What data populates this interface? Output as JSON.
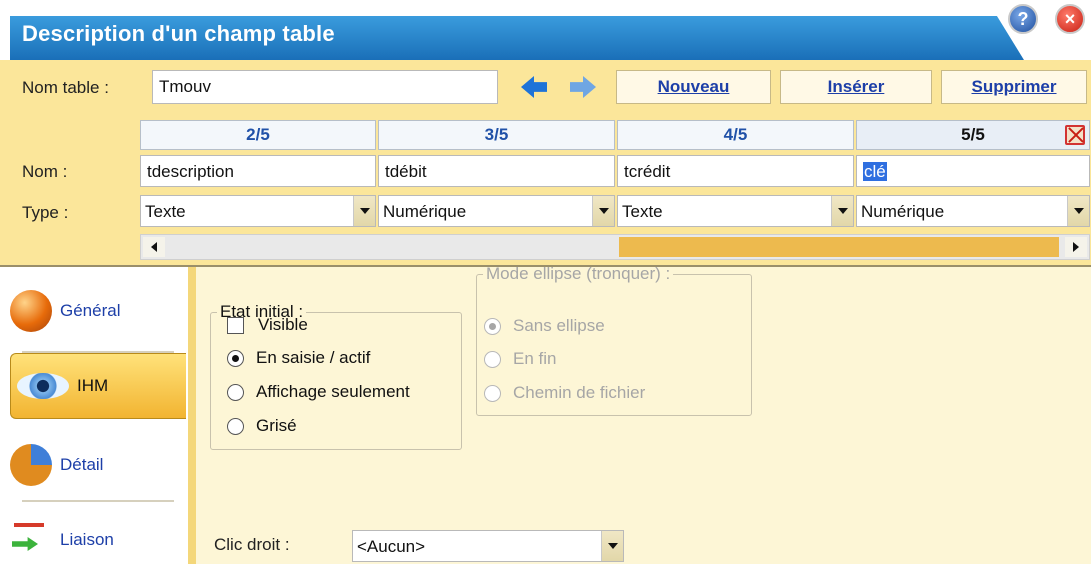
{
  "window": {
    "title": "Description d'un champ table"
  },
  "header": {
    "table_label": "Nom table :",
    "table_value": "Tmouv",
    "buttons": {
      "new": "Nouveau",
      "insert": "Insérer",
      "delete": "Supprimer"
    }
  },
  "columns": [
    {
      "head": "2/5",
      "nom": "tdescription",
      "type": "Texte"
    },
    {
      "head": "3/5",
      "nom": "tdébit",
      "type": "Numérique"
    },
    {
      "head": "4/5",
      "nom": "tcrédit",
      "type": "Texte"
    },
    {
      "head": "5/5",
      "nom": "clé",
      "type": "Numérique"
    }
  ],
  "row_labels": {
    "nom": "Nom :",
    "type": "Type :"
  },
  "tabs": [
    {
      "label": "Général",
      "icon": "general-orb-icon"
    },
    {
      "label": "IHM",
      "icon": "eye-icon"
    },
    {
      "label": "Détail",
      "icon": "pie-icon"
    },
    {
      "label": "Liaison",
      "icon": "link-icon"
    }
  ],
  "etat": {
    "legend": "Etat initial :",
    "options": [
      "Visible",
      "En saisie / actif",
      "Affichage seulement",
      "Grisé"
    ]
  },
  "ellipse": {
    "legend": "Mode ellipse (tronquer) :",
    "options": [
      "Sans ellipse",
      "En fin",
      "Chemin de fichier"
    ]
  },
  "clic_droit": {
    "label": "Clic droit :",
    "value": "<Aucun>"
  },
  "colors": {
    "accent": "#1a6fb8",
    "header_bg": "#fbe69a",
    "tab_active": "#f2b431"
  }
}
